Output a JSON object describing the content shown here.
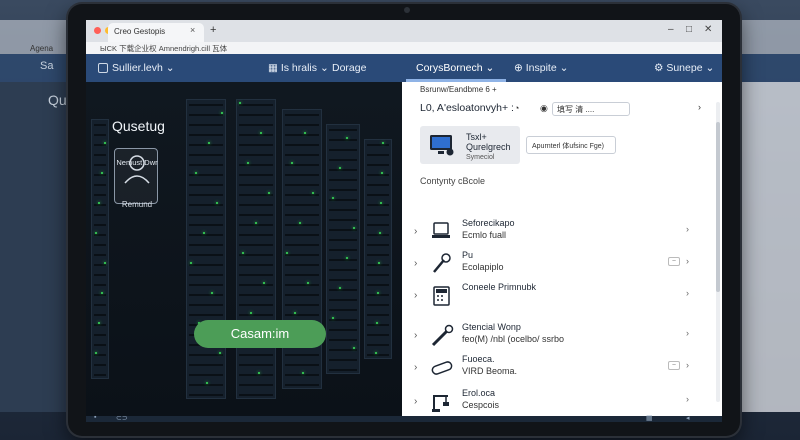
{
  "ghost": {
    "title_left": "Qu",
    "nav_left": "Sa",
    "label_left": "Agena"
  },
  "browser": {
    "tab_title": "Creo Gestopis",
    "tab_close": "×",
    "tab_new": "+",
    "url": "ЫCK 下载企业权 Amnendrigh.cill 瓦体"
  },
  "nav": {
    "items": [
      {
        "label": "Sullier.levh",
        "icon": "chevron-down-icon"
      },
      {
        "label": "Is hralis",
        "icon": "chevron-down-icon"
      },
      {
        "label": "Dorage",
        "icon": "chevron-down-icon"
      },
      {
        "label": "CorysBornech",
        "icon": "chevron-down-icon"
      },
      {
        "label": "Inspite",
        "icon": "globe-icon"
      },
      {
        "label": "Sunepe",
        "icon": "gear-icon"
      }
    ]
  },
  "left": {
    "title": "Qusetug",
    "card_label": "Nemust Dwr",
    "card_caption": "Remund",
    "button": "Casam:im"
  },
  "right": {
    "breadcrumb": "Bsrunw/Eandbme 6 +",
    "heading": "L0, A'esloatonvyh+ :",
    "pill": "填写 清 ....",
    "feature": {
      "line1": "Tsxl+",
      "line2": "Qurelgrech",
      "line3": "Symeciol"
    },
    "tag": "Apurnterl 体ufsinc Fge)",
    "section": "Contynty cBcole",
    "items": [
      {
        "title": "Seforecikapo",
        "subtitle": "Ecmlo fuall",
        "icon": "laptop-icon",
        "chip": false
      },
      {
        "title": "Pu",
        "subtitle": "Ecolapiplo",
        "icon": "tools-icon",
        "chip": true
      },
      {
        "title": "Coneele Primnubk",
        "subtitle": "",
        "icon": "calculator-icon",
        "chip": false
      },
      {
        "title": "Gtencial Wonp",
        "subtitle": "feo(M) /nbl (ocelbo/ ssrbo",
        "icon": "wrench-icon",
        "chip": false
      },
      {
        "title": "Fuoeca.",
        "subtitle": "VIRD Beoma.",
        "icon": "pill-icon",
        "chip": true
      },
      {
        "title": "Erol.oca",
        "subtitle": "Cespcois",
        "icon": "crane-icon",
        "chip": false
      }
    ]
  },
  "colors": {
    "nav_bg": "#2a4a78",
    "button_green": "#4c9d57",
    "led_green": "#3be35a"
  }
}
